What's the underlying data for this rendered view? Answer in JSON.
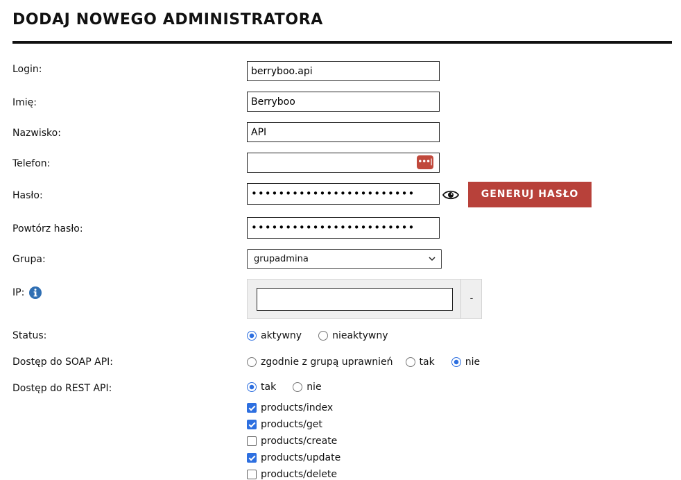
{
  "page": {
    "title": "DODAJ NOWEGO ADMINISTRATORA"
  },
  "form": {
    "login": {
      "label": "Login:",
      "value": "berryboo.api"
    },
    "first_name": {
      "label": "Imię:",
      "value": "Berryboo"
    },
    "last_name": {
      "label": "Nazwisko:",
      "value": "API"
    },
    "phone": {
      "label": "Telefon:",
      "value": "",
      "keychain_icon": "password-manager-icon",
      "keychain_glyph": "•••|"
    },
    "password": {
      "label": "Hasło:",
      "value": "••••••••••••••••••••••••",
      "show_icon": "eye-icon",
      "generate_label": "GENERUJ HASŁO"
    },
    "password_repeat": {
      "label": "Powtórz hasło:",
      "value": "••••••••••••••••••••••••"
    },
    "group": {
      "label": "Grupa:",
      "value": "grupadmina"
    },
    "ip": {
      "label": "IP:",
      "value": "",
      "info_icon": "info-icon",
      "remove_label": "-"
    },
    "status": {
      "label": "Status:",
      "options": [
        {
          "label": "aktywny",
          "checked": true
        },
        {
          "label": "nieaktywny",
          "checked": false
        }
      ]
    },
    "soap": {
      "label": "Dostęp do SOAP API:",
      "options": [
        {
          "label": "zgodnie z grupą uprawnień",
          "checked": false
        },
        {
          "label": "tak",
          "checked": false
        },
        {
          "label": "nie",
          "checked": true
        }
      ]
    },
    "rest": {
      "label": "Dostęp do REST API:",
      "options": [
        {
          "label": "tak",
          "checked": true
        },
        {
          "label": "nie",
          "checked": false
        }
      ],
      "permissions": [
        {
          "label": "products/index",
          "checked": true
        },
        {
          "label": "products/get",
          "checked": true
        },
        {
          "label": "products/create",
          "checked": false
        },
        {
          "label": "products/update",
          "checked": true
        },
        {
          "label": "products/delete",
          "checked": false
        }
      ]
    }
  },
  "colors": {
    "accent": "#2d6fe0",
    "button": "#b8413a",
    "keychain": "#c0493c",
    "info": "#2f6fb3"
  }
}
